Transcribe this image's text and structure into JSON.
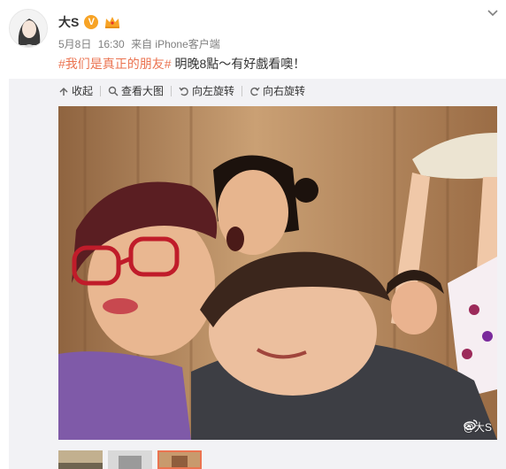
{
  "post": {
    "author": "大S",
    "verified_badge": "V",
    "date": "5月8日",
    "time": "16:30",
    "source": "来自 iPhone客户端",
    "hashtag": "#我们是真正的朋友#",
    "text": "明晚8點～有好戲看噢！"
  },
  "toolbar": {
    "collapse": "收起",
    "view_large": "查看大图",
    "rotate_left": "向左旋转",
    "rotate_right": "向右旋转"
  },
  "photo": {
    "watermark": "@大S"
  },
  "thumbnails": [
    {
      "state": "inactive"
    },
    {
      "state": "inactive"
    },
    {
      "state": "active"
    }
  ],
  "icons": [
    "avatar-portrait",
    "verified-v-icon",
    "crown-member-icon",
    "chevron-down-icon",
    "collapse-icon",
    "search-icon",
    "rotate-left-icon",
    "rotate-right-icon",
    "weibo-logo-icon"
  ],
  "colors": {
    "accent": "#eb7350",
    "link": "#eb7350",
    "meta": "#808080",
    "badge": "#f7a325"
  }
}
